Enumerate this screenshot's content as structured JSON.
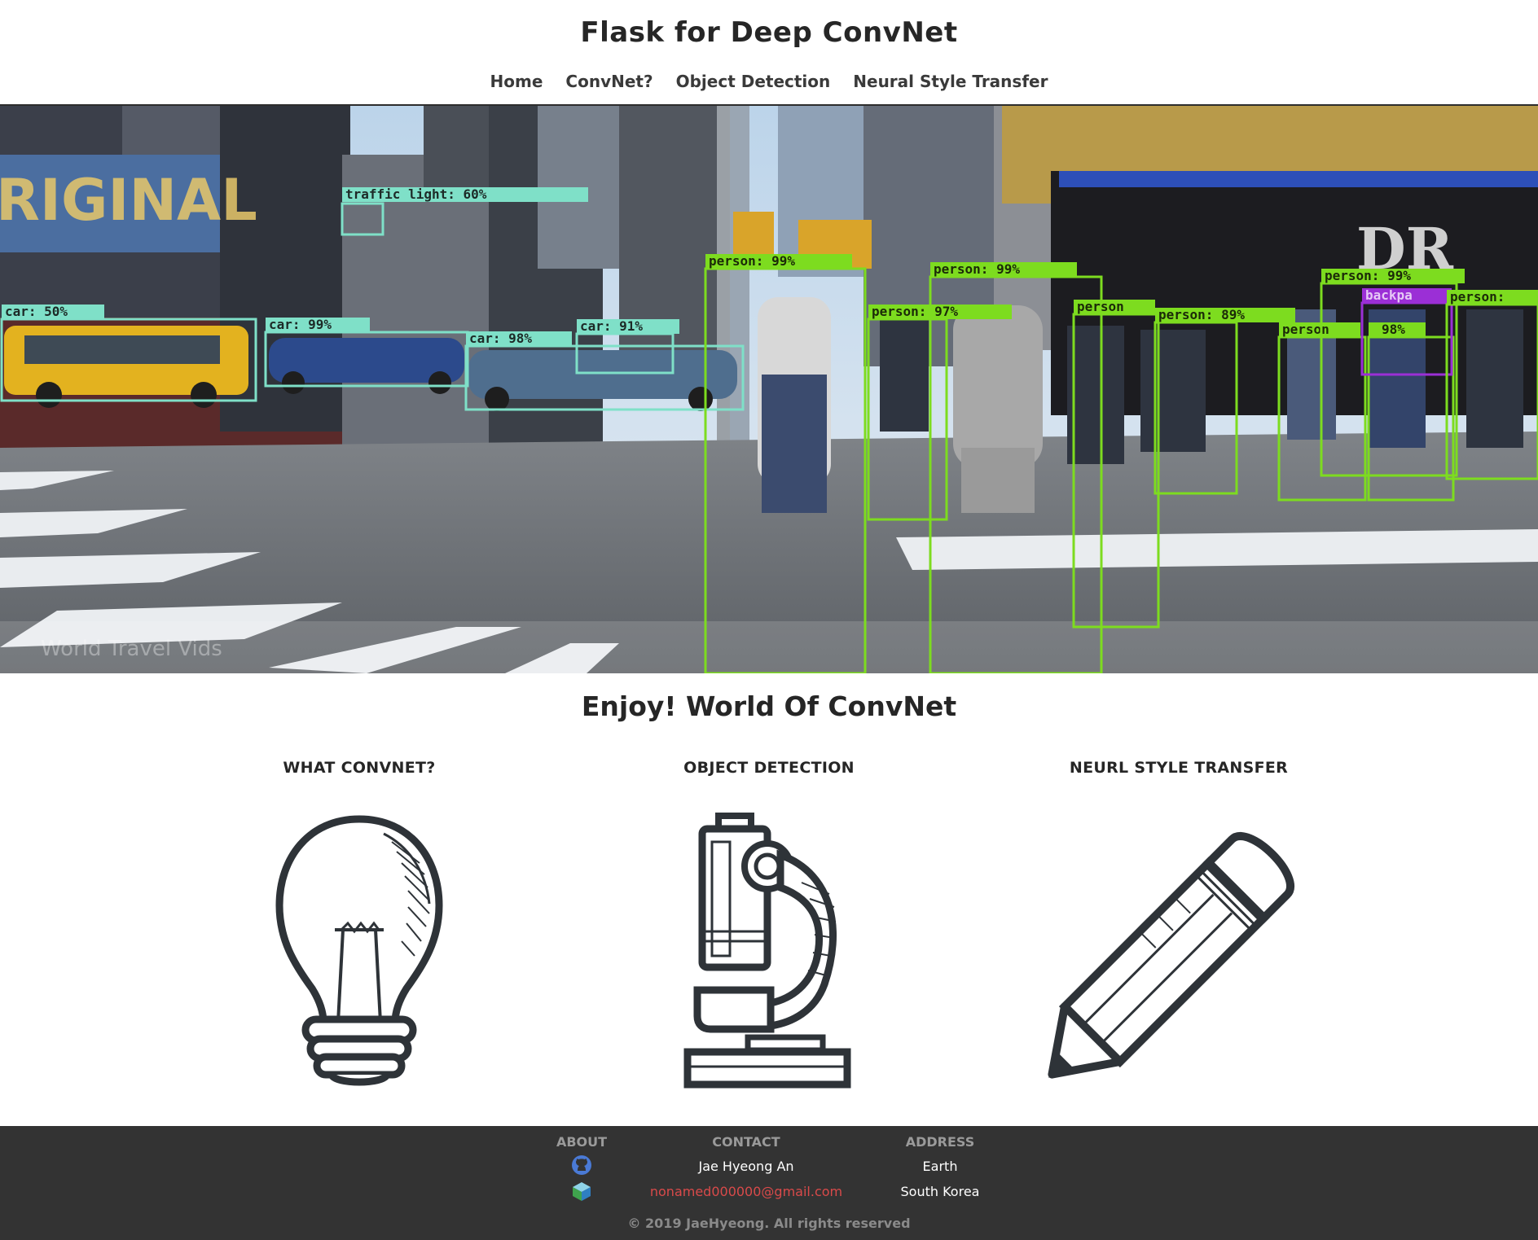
{
  "header": {
    "title": "Flask for Deep ConvNet",
    "nav": [
      "Home",
      "ConvNet?",
      "Object Detection",
      "Neural Style Transfer"
    ]
  },
  "hero": {
    "image_alt": "Object detection demo on a city street",
    "detections": [
      {
        "label": "traffic light: 60%"
      },
      {
        "label": "car: 50%"
      },
      {
        "label": "car: 99%"
      },
      {
        "label": "car: 98%"
      },
      {
        "label": "car: 91%"
      },
      {
        "label": "person: 99%"
      },
      {
        "label": "person: 99%"
      },
      {
        "label": "person: 97%"
      },
      {
        "label": "person"
      },
      {
        "label": "person: 89%"
      },
      {
        "label": "person"
      },
      {
        "label": "98%"
      },
      {
        "label": "person: 99%"
      },
      {
        "label": "backpa"
      },
      {
        "label": "person: "
      }
    ],
    "watermark": "World Travel Vids"
  },
  "main": {
    "heading": "Enjoy! World Of ConvNet",
    "features": [
      {
        "title": "WHAT CONVNET?",
        "icon": "lightbulb-icon"
      },
      {
        "title": "OBJECT DETECTION",
        "icon": "microscope-icon"
      },
      {
        "title": "NEURL STYLE TRANSFER",
        "icon": "pencil-icon"
      }
    ]
  },
  "footer": {
    "about": {
      "heading": "ABOUT",
      "icons": [
        "github-icon",
        "cube-icon"
      ]
    },
    "contact": {
      "heading": "CONTACT",
      "name": "Jae Hyeong An",
      "email": "nonamed000000@gmail.com"
    },
    "address": {
      "heading": "ADDRESS",
      "line1": "Earth",
      "line2": "South Korea"
    },
    "copyright": "© 2019 JaeHyeong. All rights reserved"
  },
  "colors": {
    "car_box": "#7fe0c8",
    "person_box": "#7ddc1f",
    "backpack_box": "#9b2fd6",
    "footer_bg": "#333333"
  }
}
